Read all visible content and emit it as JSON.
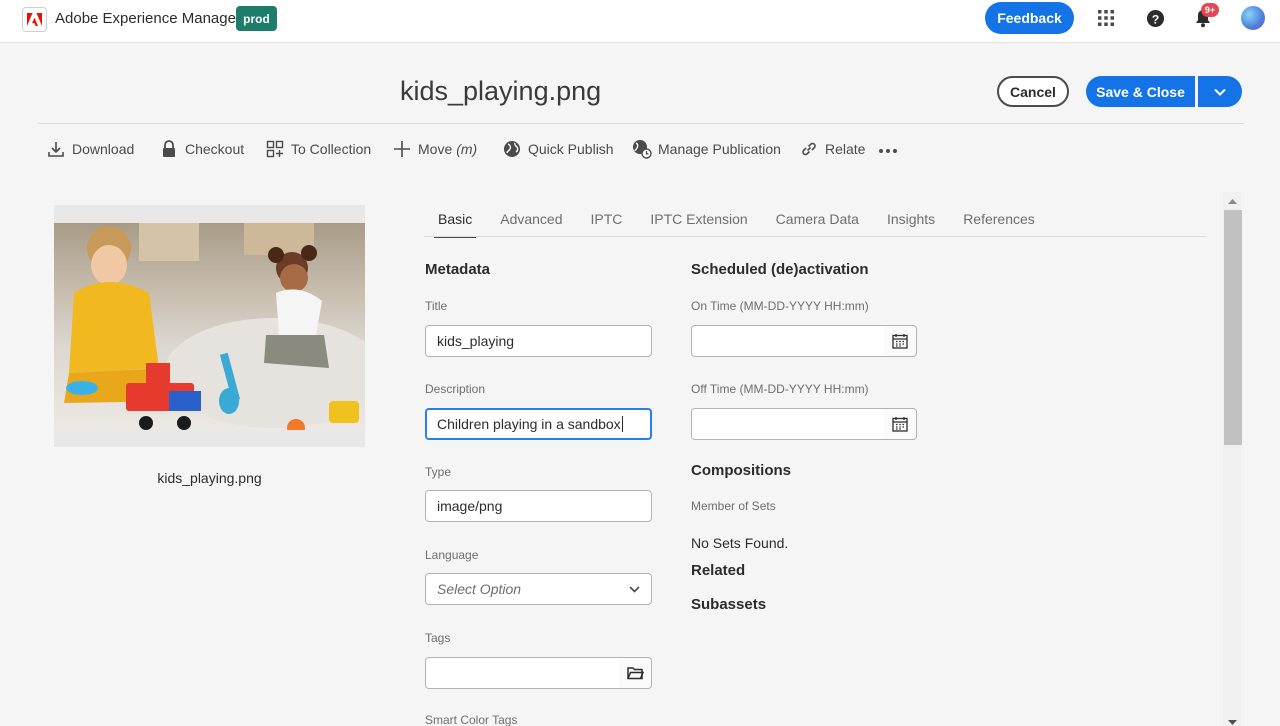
{
  "topbar": {
    "app_title": "Adobe Experience Manager",
    "env_badge": "prod",
    "feedback_label": "Feedback",
    "notification_count": "9+",
    "logo_icon": "adobe-logo-icon",
    "apps_icon": "grid-icon",
    "help_icon": "help-icon",
    "bell_icon": "bell-icon"
  },
  "header": {
    "title": "kids_playing.png",
    "cancel_label": "Cancel",
    "save_label": "Save & Close"
  },
  "actions": [
    {
      "label": "Download",
      "icon": "download-icon"
    },
    {
      "label": "Checkout",
      "icon": "lock-icon"
    },
    {
      "label": "To Collection",
      "icon": "collection-icon"
    },
    {
      "label": "Move",
      "shortcut": "(m)",
      "icon": "move-icon"
    },
    {
      "label": "Quick Publish",
      "icon": "globe-icon"
    },
    {
      "label": "Manage Publication",
      "icon": "globe-clock-icon"
    },
    {
      "label": "Relate",
      "icon": "link-icon"
    }
  ],
  "preview": {
    "file_name": "kids_playing.png"
  },
  "tabs": [
    {
      "label": "Basic",
      "active": true
    },
    {
      "label": "Advanced"
    },
    {
      "label": "IPTC"
    },
    {
      "label": "IPTC Extension"
    },
    {
      "label": "Camera Data"
    },
    {
      "label": "Insights"
    },
    {
      "label": "References"
    }
  ],
  "metadata": {
    "heading": "Metadata",
    "title_label": "Title",
    "title_value": "kids_playing",
    "description_label": "Description",
    "description_value": "Children playing in a sandbox",
    "type_label": "Type",
    "type_value": "image/png",
    "language_label": "Language",
    "language_placeholder": "Select Option",
    "tags_label": "Tags",
    "tags_value": "",
    "smart_color_tags_label": "Smart Color Tags"
  },
  "schedule": {
    "heading": "Scheduled (de)activation",
    "on_time_label": "On Time (MM-DD-YYYY HH:mm)",
    "on_time_value": "",
    "off_time_label": "Off Time (MM-DD-YYYY HH:mm)",
    "off_time_value": ""
  },
  "compositions": {
    "heading": "Compositions",
    "member_of_sets_label": "Member of Sets",
    "no_sets_text": "No Sets Found.",
    "related_heading": "Related",
    "subassets_heading": "Subassets"
  },
  "colors": {
    "accent": "#1473e6",
    "env_badge": "#1d7d6a",
    "notification": "#e34850"
  }
}
